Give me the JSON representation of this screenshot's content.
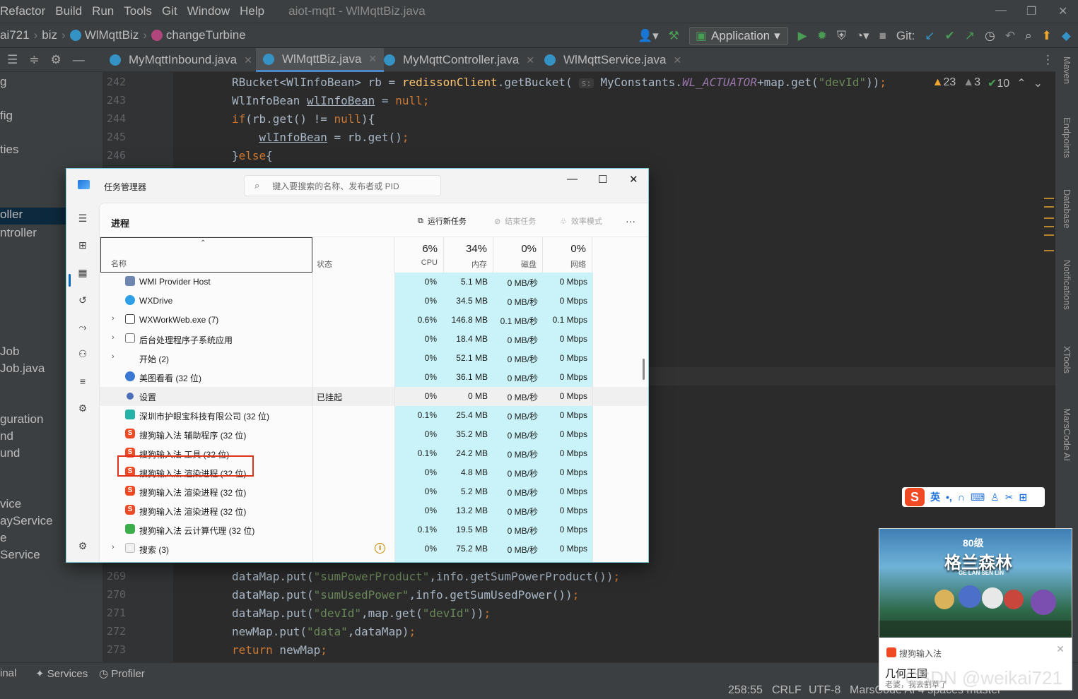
{
  "menubar": {
    "items": [
      "Refactor",
      "Build",
      "Run",
      "Tools",
      "Git",
      "Window",
      "Help"
    ],
    "window_title": "aiot-mqtt - WlMqttBiz.java"
  },
  "navbar": {
    "crumbs": [
      "ai721",
      "biz",
      "WlMqttBiz",
      "changeTurbine"
    ],
    "run_config": "Application",
    "git_label": "Git:"
  },
  "tabs": [
    {
      "label": "MyMqttInbound.java"
    },
    {
      "label": "WlMqttBiz.java"
    },
    {
      "label": "MyMqttController.java"
    },
    {
      "label": "WlMqttService.java"
    }
  ],
  "project_panel": {
    "items": [
      "g",
      "fig",
      "ties",
      "oller",
      "ntroller",
      "Job",
      "Job.java",
      "guration",
      "nd",
      "und",
      "vice",
      "ayService",
      "e",
      "Service"
    ]
  },
  "editor": {
    "line_numbers_top": [
      "242",
      "243",
      "244",
      "245",
      "246"
    ],
    "line_numbers_bottom": [
      "269",
      "270",
      "271",
      "272",
      "273"
    ],
    "inspections": {
      "warnings": "23",
      "weak": "3",
      "ok": "10"
    },
    "hint_label": "s:"
  },
  "right_tools": [
    "Maven",
    "Endpoints",
    "Database",
    "Notifications",
    "XTools",
    "MarsCode AI"
  ],
  "statusbar": {
    "left_items": [
      "inal",
      "Services",
      "Profiler"
    ],
    "position": "258:55",
    "line_sep": "CRLF",
    "encoding": "UTF-8",
    "tail": "MarsCode AI   4 spaces   master"
  },
  "taskmgr": {
    "title": "任务管理器",
    "search_placeholder": "键入要搜索的名称、发布者或 PID",
    "page_title": "进程",
    "actions": {
      "run_new": "运行新任务",
      "end_task": "结束任务",
      "efficiency": "效率模式",
      "more": "···"
    },
    "columns": {
      "name": "名称",
      "status": "状态",
      "cpu": {
        "pct": "6%",
        "label": "CPU"
      },
      "mem": {
        "pct": "34%",
        "label": "内存"
      },
      "disk": {
        "pct": "0%",
        "label": "磁盘"
      },
      "net": {
        "pct": "0%",
        "label": "网络"
      }
    },
    "rows": [
      {
        "name": "WMI Provider Host",
        "status": "",
        "cpu": "0%",
        "mem": "5.1 MB",
        "disk": "0 MB/秒",
        "net": "0 Mbps"
      },
      {
        "name": "WXDrive",
        "status": "",
        "cpu": "0%",
        "mem": "34.5 MB",
        "disk": "0 MB/秒",
        "net": "0 Mbps"
      },
      {
        "name": "WXWorkWeb.exe (7)",
        "status": "",
        "cpu": "0.6%",
        "mem": "146.8 MB",
        "disk": "0.1 MB/秒",
        "net": "0.1 Mbps"
      },
      {
        "name": "后台处理程序子系统应用",
        "status": "",
        "cpu": "0%",
        "mem": "18.4 MB",
        "disk": "0 MB/秒",
        "net": "0 Mbps"
      },
      {
        "name": "开始 (2)",
        "status": "",
        "cpu": "0%",
        "mem": "52.1 MB",
        "disk": "0 MB/秒",
        "net": "0 Mbps"
      },
      {
        "name": "美图看看 (32 位)",
        "status": "",
        "cpu": "0%",
        "mem": "36.1 MB",
        "disk": "0 MB/秒",
        "net": "0 Mbps"
      },
      {
        "name": "设置",
        "status": "已挂起",
        "cpu": "0%",
        "mem": "0 MB",
        "disk": "0 MB/秒",
        "net": "0 Mbps"
      },
      {
        "name": "深圳市护眼宝科技有限公司 (32 位)",
        "status": "",
        "cpu": "0.1%",
        "mem": "25.4 MB",
        "disk": "0 MB/秒",
        "net": "0 Mbps"
      },
      {
        "name": "搜狗输入法 辅助程序 (32 位)",
        "status": "",
        "cpu": "0%",
        "mem": "35.2 MB",
        "disk": "0 MB/秒",
        "net": "0 Mbps"
      },
      {
        "name": "搜狗输入法 工具 (32 位)",
        "status": "",
        "cpu": "0.1%",
        "mem": "24.2 MB",
        "disk": "0 MB/秒",
        "net": "0 Mbps"
      },
      {
        "name": "搜狗输入法 渲染进程 (32 位)",
        "status": "",
        "cpu": "0%",
        "mem": "4.8 MB",
        "disk": "0 MB/秒",
        "net": "0 Mbps"
      },
      {
        "name": "搜狗输入法 渲染进程 (32 位)",
        "status": "",
        "cpu": "0%",
        "mem": "5.2 MB",
        "disk": "0 MB/秒",
        "net": "0 Mbps"
      },
      {
        "name": "搜狗输入法 渲染进程 (32 位)",
        "status": "",
        "cpu": "0%",
        "mem": "13.2 MB",
        "disk": "0 MB/秒",
        "net": "0 Mbps"
      },
      {
        "name": "搜狗输入法 云计算代理 (32 位)",
        "status": "",
        "cpu": "0.1%",
        "mem": "19.5 MB",
        "disk": "0 MB/秒",
        "net": "0 Mbps"
      },
      {
        "name": "搜索 (3)",
        "status": "",
        "cpu": "0%",
        "mem": "75.2 MB",
        "disk": "0 MB/秒",
        "net": "0 Mbps"
      }
    ]
  },
  "sogou_bar": {
    "lang": "英"
  },
  "ad": {
    "level": "80级",
    "game_name": "格兰森林",
    "game_pinyin": "GE LAN SEN LIN",
    "source": "搜狗输入法",
    "title": "几何王国",
    "desc": "老婆，我去割草了"
  },
  "watermark": "CSDN @weikai721",
  "colors": {
    "accent": "#4a88c7",
    "heat": "#c9f3f8",
    "highlight_box": "#e0301e",
    "sogou": "#ef4a24"
  }
}
